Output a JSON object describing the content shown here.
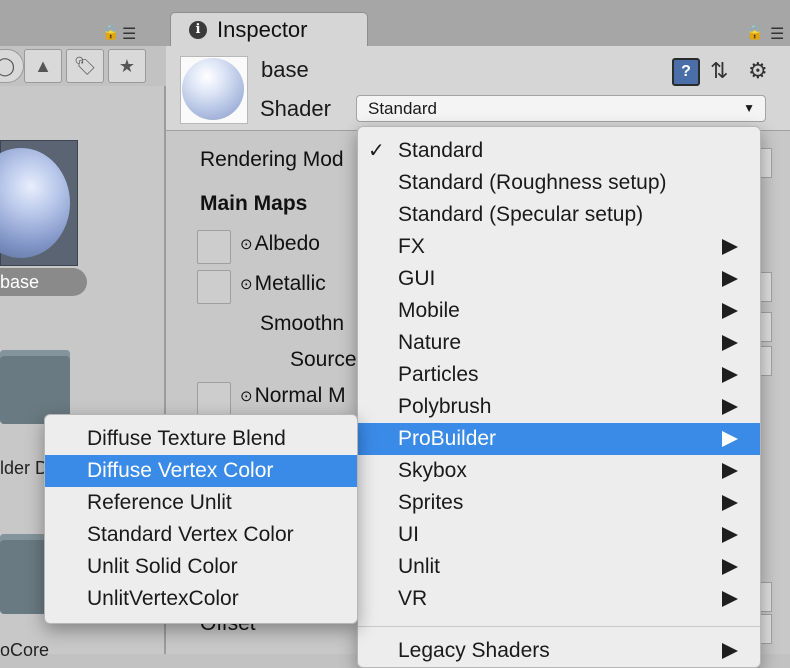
{
  "colors": {
    "accent": "#3a8be8",
    "panel_bg": "#c8c8c8",
    "header_bg": "#d6d6d6",
    "menu_bg": "#ededed"
  },
  "left_panel": {
    "asset_label": "base",
    "folder_label_1": "lder D",
    "folder_label_2": "oCore",
    "toolbar_icons": [
      "search-icon",
      "filter-icon",
      "label-icon",
      "star-icon"
    ]
  },
  "inspector": {
    "tab_title": "Inspector",
    "material_name": "base",
    "shader_label": "Shader",
    "shader_value": "Standard",
    "header_icons": [
      "help-icon",
      "preset-icon",
      "gear-icon"
    ],
    "properties": {
      "rendering_mode": "Rendering Mod",
      "main_maps": "Main Maps",
      "albedo": "Albedo",
      "metallic": "Metallic",
      "smoothness": "Smoothn",
      "source": "Source",
      "normal_map": "Normal M",
      "offset": "Offset"
    }
  },
  "shader_menu": {
    "items": [
      {
        "label": "Standard",
        "checked": true,
        "submenu": false
      },
      {
        "label": "Standard (Roughness setup)",
        "checked": false,
        "submenu": false
      },
      {
        "label": "Standard (Specular setup)",
        "checked": false,
        "submenu": false
      },
      {
        "label": "FX",
        "checked": false,
        "submenu": true
      },
      {
        "label": "GUI",
        "checked": false,
        "submenu": true
      },
      {
        "label": "Mobile",
        "checked": false,
        "submenu": true
      },
      {
        "label": "Nature",
        "checked": false,
        "submenu": true
      },
      {
        "label": "Particles",
        "checked": false,
        "submenu": true
      },
      {
        "label": "Polybrush",
        "checked": false,
        "submenu": true
      },
      {
        "label": "ProBuilder",
        "checked": false,
        "submenu": true,
        "highlighted": true
      },
      {
        "label": "Skybox",
        "checked": false,
        "submenu": true
      },
      {
        "label": "Sprites",
        "checked": false,
        "submenu": true
      },
      {
        "label": "UI",
        "checked": false,
        "submenu": true
      },
      {
        "label": "Unlit",
        "checked": false,
        "submenu": true
      },
      {
        "label": "VR",
        "checked": false,
        "submenu": true
      },
      {
        "label": "Legacy Shaders",
        "checked": false,
        "submenu": true
      }
    ],
    "check_glyph": "✓"
  },
  "probuilder_submenu": {
    "items": [
      {
        "label": "Diffuse Texture Blend"
      },
      {
        "label": "Diffuse Vertex Color",
        "highlighted": true
      },
      {
        "label": "Reference Unlit"
      },
      {
        "label": "Standard Vertex Color"
      },
      {
        "label": "Unlit Solid Color"
      },
      {
        "label": "UnlitVertexColor"
      }
    ]
  }
}
